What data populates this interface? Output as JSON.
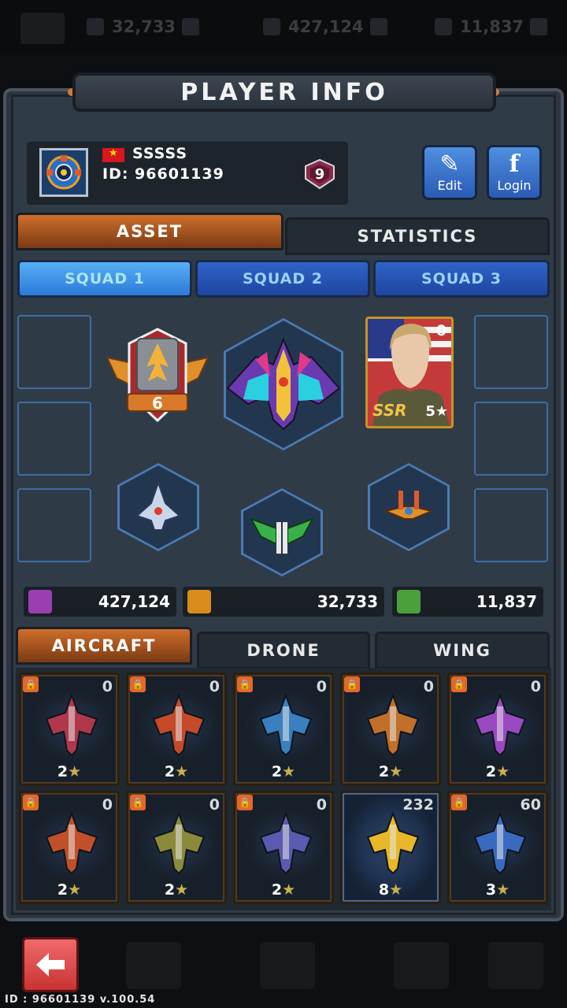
{
  "top_hud": {
    "items": [
      {
        "value": "32,733"
      },
      {
        "value": "427,124"
      },
      {
        "value": "11,837"
      }
    ]
  },
  "modal": {
    "title": "PLAYER INFO"
  },
  "profile": {
    "name": "SSSSS",
    "id_text": "ID: 96601139",
    "rank_level": "9",
    "edit_label": "Edit",
    "login_label": "Login"
  },
  "tabs": {
    "asset": "ASSET",
    "statistics": "STATISTICS"
  },
  "squads": [
    "SQUAD 1",
    "SQUAD 2",
    "SQUAD 3"
  ],
  "loadout": {
    "rank_badge_value": "6",
    "pilot_card": {
      "count": "0",
      "rarity": "SSR",
      "stars": "5★"
    }
  },
  "resources": [
    {
      "value": "427,124",
      "icon": "gem-crate-icon",
      "color": "#9b3fb0"
    },
    {
      "value": "32,733",
      "icon": "gold-parts-icon",
      "color": "#d98c1c"
    },
    {
      "value": "11,837",
      "icon": "green-parts-icon",
      "color": "#4aa03a"
    }
  ],
  "sub_tabs": [
    "AIRCRAFT",
    "DRONE",
    "WING"
  ],
  "aircraft": [
    {
      "count": "0",
      "stars": "2",
      "locked": true,
      "color": "#b0384a"
    },
    {
      "count": "0",
      "stars": "2",
      "locked": true,
      "color": "#c44a2a"
    },
    {
      "count": "0",
      "stars": "2",
      "locked": true,
      "color": "#3a7fc0"
    },
    {
      "count": "0",
      "stars": "2",
      "locked": true,
      "color": "#c0702a"
    },
    {
      "count": "0",
      "stars": "2",
      "locked": true,
      "color": "#9a4ac0"
    },
    {
      "count": "0",
      "stars": "2",
      "locked": true,
      "color": "#c0502a"
    },
    {
      "count": "0",
      "stars": "2",
      "locked": true,
      "color": "#8a8a3a"
    },
    {
      "count": "0",
      "stars": "2",
      "locked": true,
      "color": "#5a5ab0"
    },
    {
      "count": "232",
      "stars": "8",
      "locked": false,
      "color": "#e8b82a"
    },
    {
      "count": "60",
      "stars": "3",
      "locked": true,
      "color": "#3a6ac0"
    }
  ],
  "footer": {
    "build_text": "ID : 96601139 v.100.54"
  }
}
